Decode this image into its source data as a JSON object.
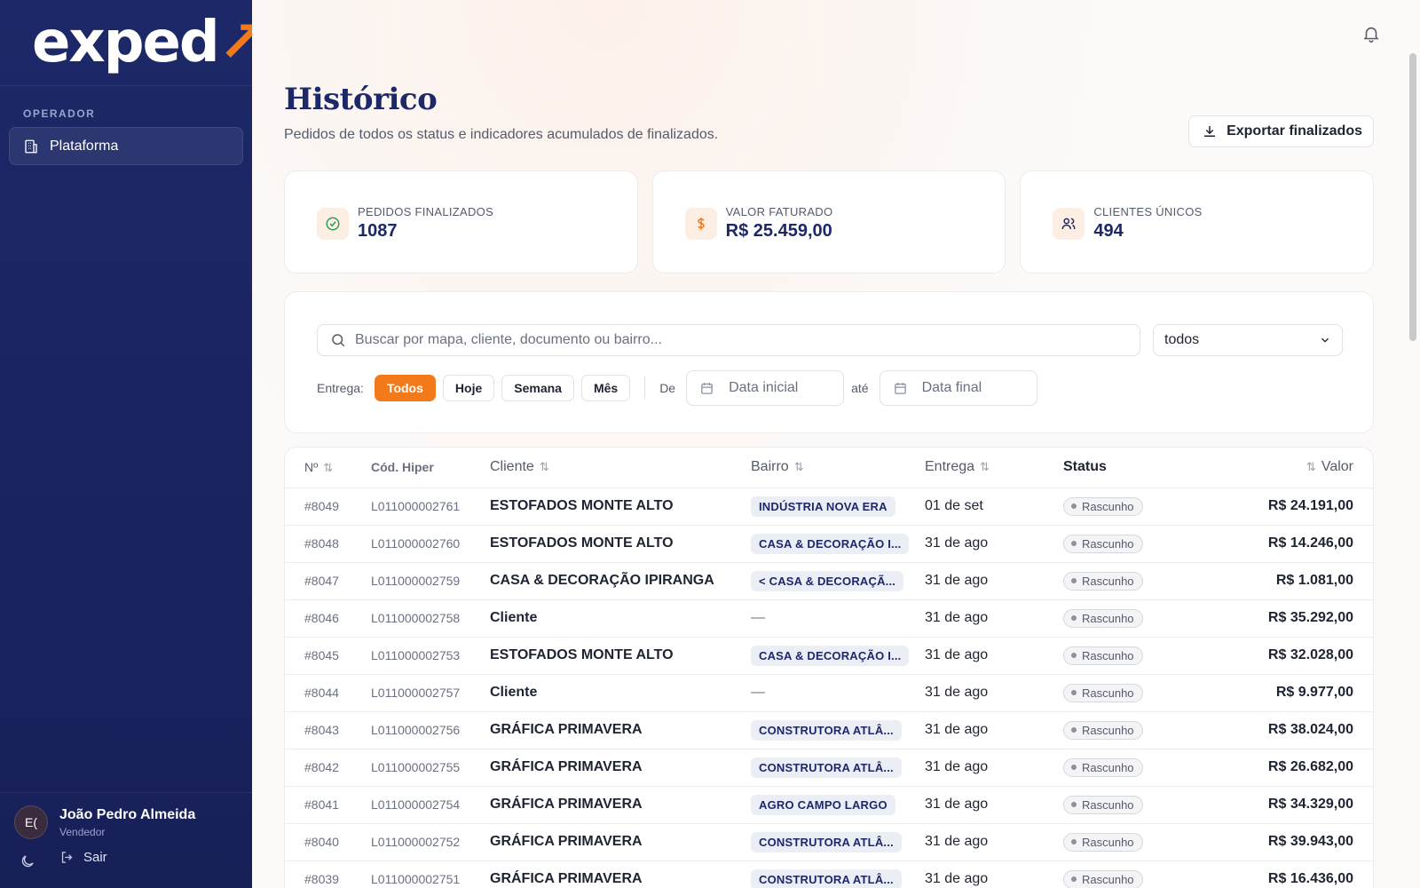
{
  "brand": {
    "logo_main": "exped",
    "logo_accent": "↗"
  },
  "sidebar": {
    "section_label": "OPERADOR",
    "items": [
      {
        "label": "Plataforma",
        "icon": "building-icon"
      }
    ]
  },
  "user": {
    "initials": "E(",
    "name": "João Pedro Almeida",
    "role": "Vendedor",
    "logout_label": "Sair"
  },
  "header": {
    "title": "Histórico",
    "subtitle": "Pedidos de todos os status e indicadores acumulados de finalizados.",
    "export_label": "Exportar finalizados"
  },
  "kpis": [
    {
      "label": "PEDIDOS FINALIZADOS",
      "value": "1087",
      "icon": "check-circle-icon",
      "color": "#2e9e5b"
    },
    {
      "label": "VALOR FATURADO",
      "value": "R$ 25.459,00",
      "icon": "dollar-icon",
      "color": "#f27a1a"
    },
    {
      "label": "CLIENTES ÚNICOS",
      "value": "494",
      "icon": "users-icon",
      "color": "#1d2868"
    }
  ],
  "filters": {
    "search_placeholder": "Buscar por mapa, cliente, documento ou bairro...",
    "status_select": "todos",
    "delivery_label": "Entrega:",
    "delivery_options": [
      "Todos",
      "Hoje",
      "Semana",
      "Mês"
    ],
    "delivery_selected": "Todos",
    "from_label": "De",
    "from_placeholder": "Data inicial",
    "to_label": "até",
    "to_placeholder": "Data final"
  },
  "table": {
    "columns": {
      "num": "Nº",
      "code": "Cód. Hiper",
      "client": "Cliente",
      "bairro": "Bairro",
      "entrega": "Entrega",
      "status": "Status",
      "valor": "Valor"
    },
    "rows": [
      {
        "num": "#8049",
        "code": "L011000002761",
        "client": "ESTOFADOS MONTE ALTO",
        "bairro": "INDÚSTRIA NOVA ERA",
        "entrega": "01 de set",
        "status": "Rascunho",
        "valor": "R$ 24.191,00"
      },
      {
        "num": "#8048",
        "code": "L011000002760",
        "client": "ESTOFADOS MONTE ALTO",
        "bairro": "CASA & DECORAÇÃO I...",
        "entrega": "31 de ago",
        "status": "Rascunho",
        "valor": "R$ 14.246,00"
      },
      {
        "num": "#8047",
        "code": "L011000002759",
        "client": "CASA & DECORAÇÃO IPIRANGA",
        "bairro": "< CASA & DECORAÇÃ...",
        "entrega": "31 de ago",
        "status": "Rascunho",
        "valor": "R$ 1.081,00"
      },
      {
        "num": "#8046",
        "code": "L011000002758",
        "client": "Cliente",
        "bairro": "—",
        "entrega": "31 de ago",
        "status": "Rascunho",
        "valor": "R$ 35.292,00"
      },
      {
        "num": "#8045",
        "code": "L011000002753",
        "client": "ESTOFADOS MONTE ALTO",
        "bairro": "CASA & DECORAÇÃO I...",
        "entrega": "31 de ago",
        "status": "Rascunho",
        "valor": "R$ 32.028,00"
      },
      {
        "num": "#8044",
        "code": "L011000002757",
        "client": "Cliente",
        "bairro": "—",
        "entrega": "31 de ago",
        "status": "Rascunho",
        "valor": "R$ 9.977,00"
      },
      {
        "num": "#8043",
        "code": "L011000002756",
        "client": "GRÁFICA PRIMAVERA",
        "bairro": "CONSTRUTORA ATLÂ...",
        "entrega": "31 de ago",
        "status": "Rascunho",
        "valor": "R$ 38.024,00"
      },
      {
        "num": "#8042",
        "code": "L011000002755",
        "client": "GRÁFICA PRIMAVERA",
        "bairro": "CONSTRUTORA ATLÂ...",
        "entrega": "31 de ago",
        "status": "Rascunho",
        "valor": "R$ 26.682,00"
      },
      {
        "num": "#8041",
        "code": "L011000002754",
        "client": "GRÁFICA PRIMAVERA",
        "bairro": "AGRO CAMPO LARGO",
        "entrega": "31 de ago",
        "status": "Rascunho",
        "valor": "R$ 34.329,00"
      },
      {
        "num": "#8040",
        "code": "L011000002752",
        "client": "GRÁFICA PRIMAVERA",
        "bairro": "CONSTRUTORA ATLÂ...",
        "entrega": "31 de ago",
        "status": "Rascunho",
        "valor": "R$ 39.943,00"
      },
      {
        "num": "#8039",
        "code": "L011000002751",
        "client": "GRÁFICA PRIMAVERA",
        "bairro": "CONSTRUTORA ATLÂ...",
        "entrega": "31 de ago",
        "status": "Rascunho",
        "valor": "R$ 16.436,00"
      }
    ]
  },
  "colors": {
    "brand_navy": "#1d2868",
    "accent_orange": "#f27a1a"
  }
}
